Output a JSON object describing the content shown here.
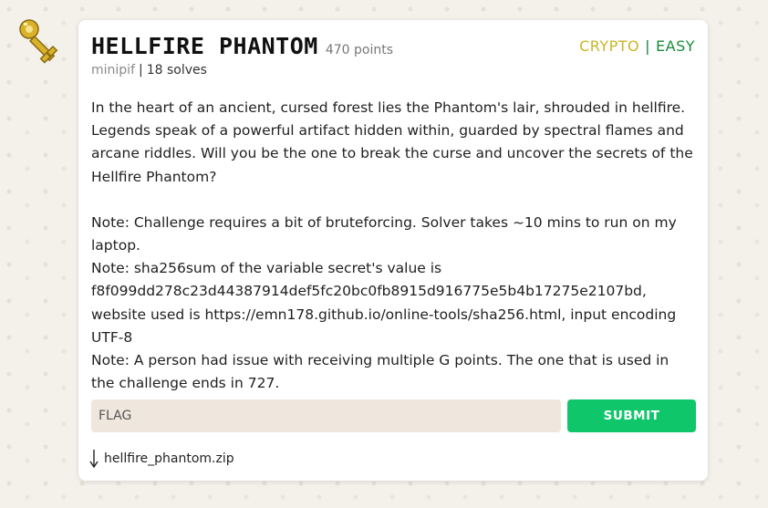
{
  "challenge": {
    "title": "HELLFIRE PHANTOM",
    "points": "470 points",
    "author": "minipif",
    "separator": "|",
    "solves": "18 solves",
    "category": "CRYPTO",
    "tag_separator": "|",
    "difficulty": "EASY",
    "description": [
      "In the heart of an ancient, cursed forest lies the Phantom's lair, shrouded in hellfire. Legends speak of a powerful artifact hidden within, guarded by spectral flames and arcane riddles. Will you be the one to break the curse and uncover the secrets of the Hellfire Phantom?",
      "Note: Challenge requires a bit of bruteforcing. Solver takes ~10 mins to run on my laptop.",
      "Note: sha256sum of the variable secret's value is f8f099dd278c23d44387914def5fc20bc0fb8915d916775e5b4b17275e2107bd, website used is https://emn178.github.io/online-tools/sha256.html, input encoding UTF-8",
      "Note: A person had issue with receiving multiple G points. The one that is used in the challenge ends in 727."
    ],
    "flag_placeholder": "FLAG",
    "flag_value": "",
    "submit_label": "SUBMIT",
    "attachment_name": "hellfire_phantom.zip"
  },
  "icons": {
    "key": "key-icon",
    "download": "download-arrow-icon"
  },
  "colors": {
    "category": "#c9b52a",
    "difficulty": "#1a8a3a",
    "submit": "#0fc66a",
    "input_bg": "#efe6de"
  }
}
